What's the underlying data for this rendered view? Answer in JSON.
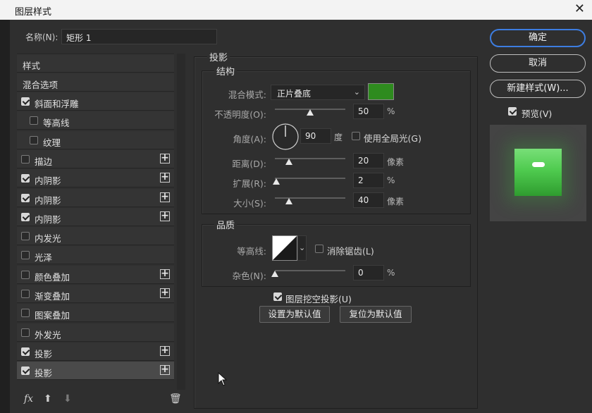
{
  "window": {
    "title": "图层样式",
    "close_glyph": "✕"
  },
  "name_field": {
    "label": "名称(N):",
    "value": "矩形 1"
  },
  "styles_list": {
    "header": "样式",
    "blend_options": "混合选项",
    "items": [
      {
        "label": "斜面和浮雕",
        "checked": true,
        "plus": false,
        "indent": false
      },
      {
        "label": "等高线",
        "checked": false,
        "plus": false,
        "indent": true
      },
      {
        "label": "纹理",
        "checked": false,
        "plus": false,
        "indent": true
      },
      {
        "label": "描边",
        "checked": false,
        "plus": true,
        "indent": false
      },
      {
        "label": "内阴影",
        "checked": true,
        "plus": true,
        "indent": false
      },
      {
        "label": "内阴影",
        "checked": true,
        "plus": true,
        "indent": false
      },
      {
        "label": "内阴影",
        "checked": true,
        "plus": true,
        "indent": false
      },
      {
        "label": "内发光",
        "checked": false,
        "plus": false,
        "indent": false
      },
      {
        "label": "光泽",
        "checked": false,
        "plus": false,
        "indent": false
      },
      {
        "label": "颜色叠加",
        "checked": false,
        "plus": true,
        "indent": false
      },
      {
        "label": "渐变叠加",
        "checked": false,
        "plus": true,
        "indent": false
      },
      {
        "label": "图案叠加",
        "checked": false,
        "plus": false,
        "indent": false
      },
      {
        "label": "外发光",
        "checked": false,
        "plus": false,
        "indent": false
      },
      {
        "label": "投影",
        "checked": true,
        "plus": true,
        "indent": false
      },
      {
        "label": "投影",
        "checked": true,
        "plus": true,
        "indent": false,
        "selected": true
      }
    ],
    "plus_glyph": "+",
    "bottom_icons": {
      "fx": "fx",
      "up": "⬆",
      "down": "⬇",
      "trash": "🗑"
    }
  },
  "drop_shadow": {
    "section_title": "投影",
    "structure": {
      "title": "结构",
      "blend_mode_label": "混合模式:",
      "blend_mode_value": "正片叠底",
      "color": "#2e8b1e",
      "opacity": {
        "label": "不透明度(O):",
        "value": "50",
        "unit": "%",
        "fraction": 0.5
      },
      "angle": {
        "label": "角度(A):",
        "value": "90",
        "unit": "度",
        "degrees": 90
      },
      "global_light": {
        "label": "使用全局光(G)",
        "checked": false
      },
      "distance": {
        "label": "距离(D):",
        "value": "20",
        "unit": "像素",
        "fraction": 0.2
      },
      "spread": {
        "label": "扩展(R):",
        "value": "2",
        "unit": "%",
        "fraction": 0.02
      },
      "size": {
        "label": "大小(S):",
        "value": "40",
        "unit": "像素",
        "fraction": 0.2
      }
    },
    "quality": {
      "title": "品质",
      "contour_label": "等高线:",
      "antialias": {
        "label": "消除锯齿(L)",
        "checked": false
      },
      "noise": {
        "label": "杂色(N):",
        "value": "0",
        "unit": "%",
        "fraction": 0.0
      }
    },
    "knockout": {
      "label": "图层挖空投影(U)",
      "checked": true
    },
    "set_default": "设置为默认值",
    "reset_default": "复位为默认值"
  },
  "right_panel": {
    "ok": "确定",
    "cancel": "取消",
    "new_style": "新建样式(W)...",
    "preview": {
      "label": "预览(V)",
      "checked": true
    }
  },
  "colors": {
    "accent": "#3d7de0",
    "preview_green": "#4fcb4f"
  }
}
